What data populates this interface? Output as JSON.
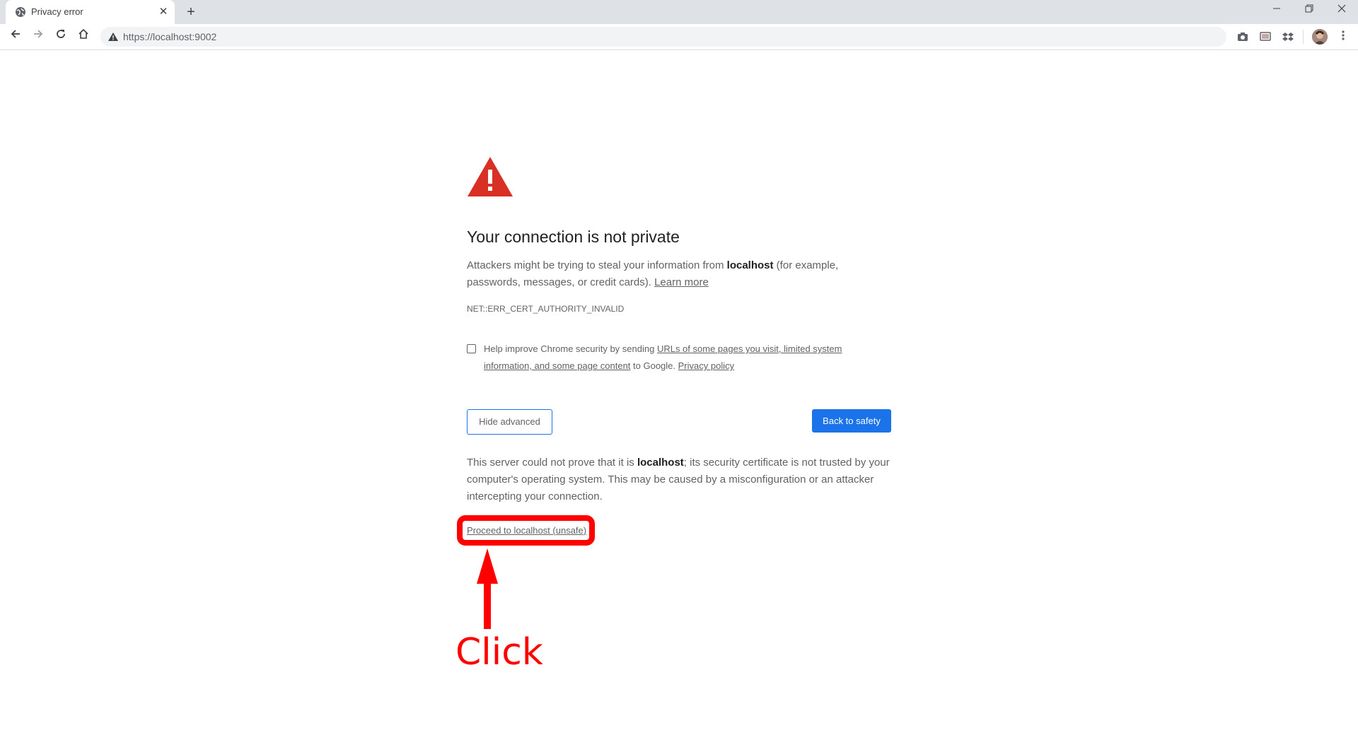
{
  "browser": {
    "tab": {
      "title": "Privacy error",
      "close": "✕"
    },
    "new_tab": "+",
    "window": {
      "minimize": "—",
      "maximize": "❐",
      "close": "✕"
    },
    "address": {
      "url": "https://localhost:9002"
    },
    "icons": [
      "back-icon",
      "forward-icon",
      "reload-icon",
      "home-icon",
      "not-secure-icon",
      "camera-icon",
      "cast-icon",
      "dropbox-icon",
      "profile-avatar",
      "menu-icon"
    ]
  },
  "interstitial": {
    "heading": "Your connection is not private",
    "intro_prefix": "Attackers might be trying to steal your information from ",
    "intro_host": "localhost",
    "intro_suffix": " (for example, passwords, messages, or credit cards). ",
    "learn_more": "Learn more",
    "error_code": "NET::ERR_CERT_AUTHORITY_INVALID",
    "reporting": {
      "prefix": "Help improve Chrome security by sending ",
      "link": "URLs of some pages you visit, limited system information, and some page content",
      "middle": " to Google. ",
      "privacy_link": "Privacy policy",
      "checked": false
    },
    "hide_advanced": "Hide advanced",
    "back_to_safety": "Back to safety",
    "details_prefix": "This server could not prove that it is ",
    "details_host": "localhost",
    "details_suffix": "; its security certificate is not trusted by your computer's operating system. This may be caused by a misconfiguration or an attacker intercepting your connection.",
    "proceed_link": "Proceed to localhost (unsafe)"
  },
  "annotation": {
    "label": "Click",
    "color": "#ff0000"
  },
  "colors": {
    "accent": "#1a73e8",
    "warning": "#d93025"
  }
}
